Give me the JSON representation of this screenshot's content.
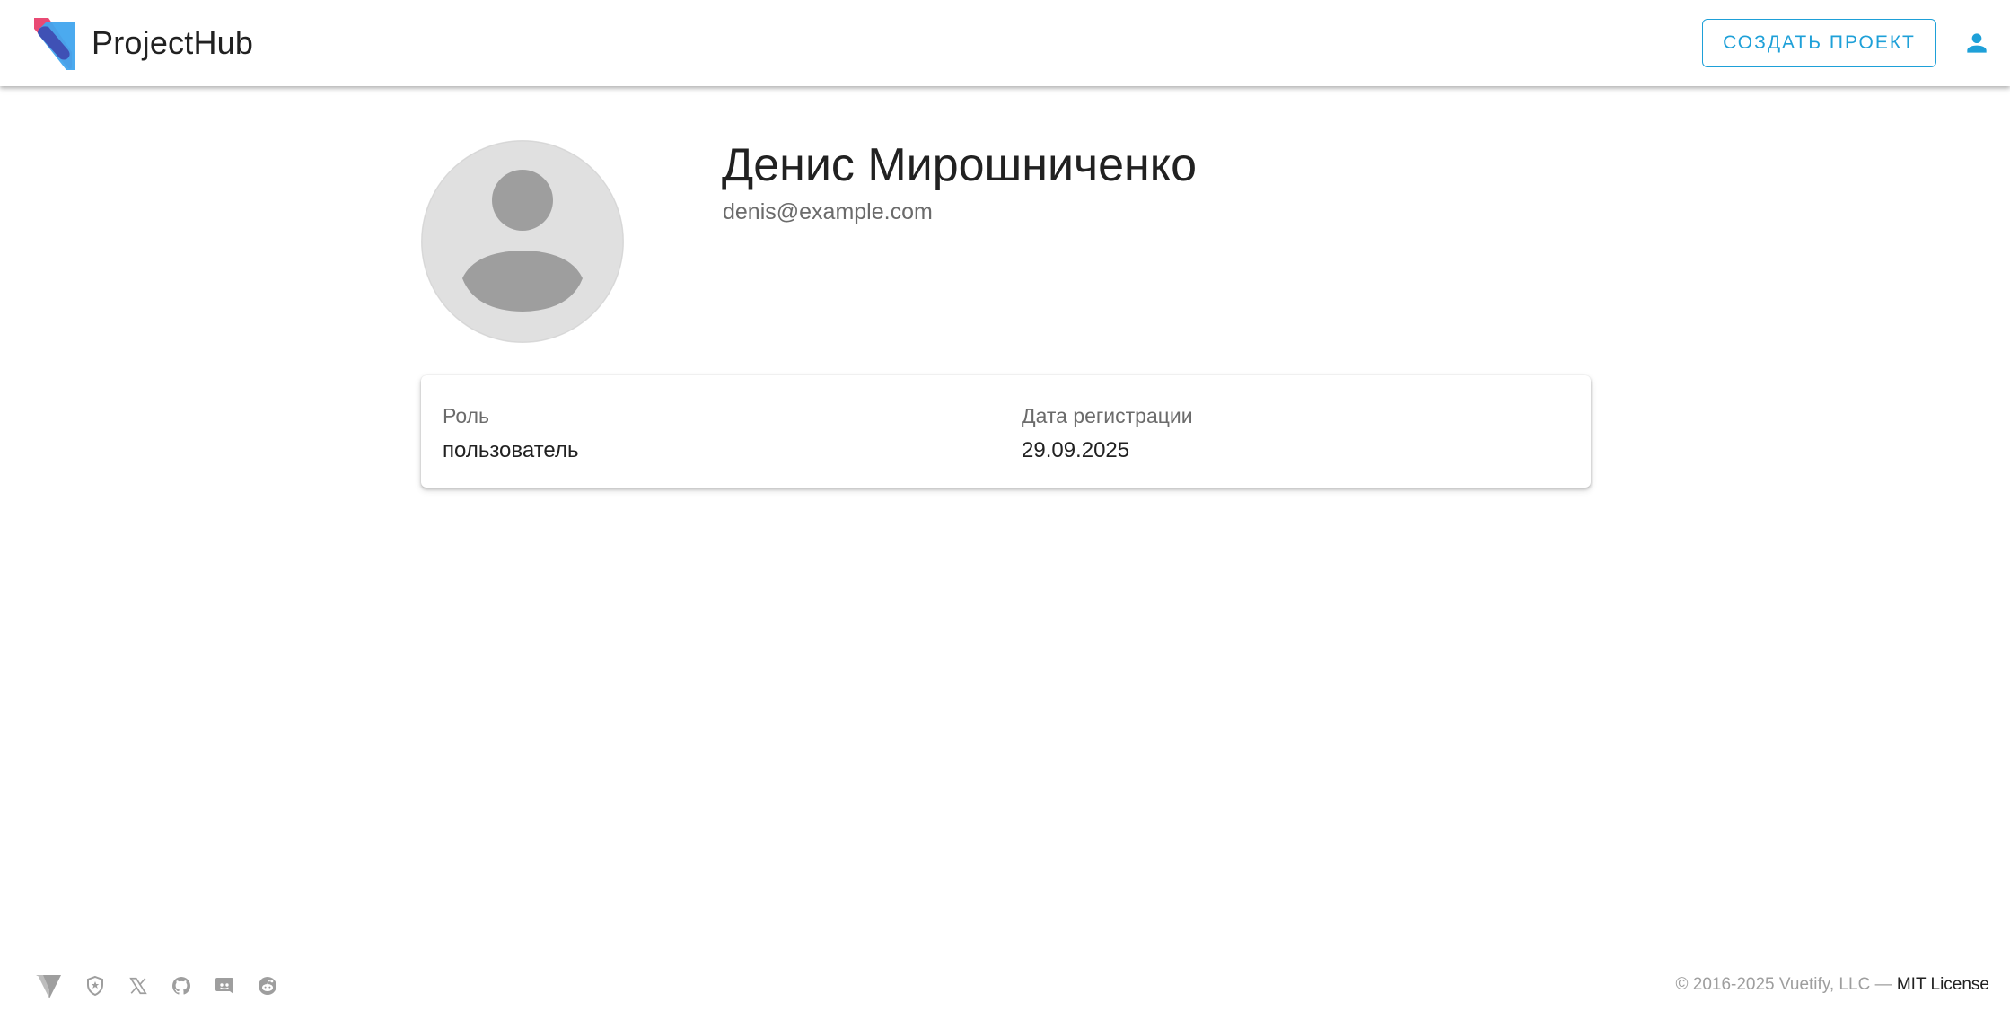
{
  "app": {
    "title": "ProjectHub",
    "create_project_label": "Создать проект"
  },
  "icons": {
    "logo": "vuetify-logo-icon",
    "account": "account-icon",
    "avatar_placeholder": "person-placeholder-icon",
    "footer": [
      "vuetify-icon",
      "shield-icon",
      "x-twitter-icon",
      "github-icon",
      "discord-icon",
      "reddit-icon"
    ]
  },
  "profile": {
    "name": "Денис Мирошниченко",
    "email": "denis@example.com"
  },
  "details": {
    "role_label": "Роль",
    "role_value": "пользователь",
    "date_label": "Дата регистрации",
    "date_value": "29.09.2025"
  },
  "footer": {
    "copyright": "© 2016-2025 Vuetify, LLC —",
    "license_label": "MIT License"
  },
  "colors": {
    "accent": "#1ea0d8",
    "logo_pink": "#e8406d",
    "logo_blue": "#41a5ee",
    "logo_indigo": "#3f51b5",
    "avatar_bg": "#e0e0e0",
    "avatar_fg": "#9e9e9e"
  }
}
